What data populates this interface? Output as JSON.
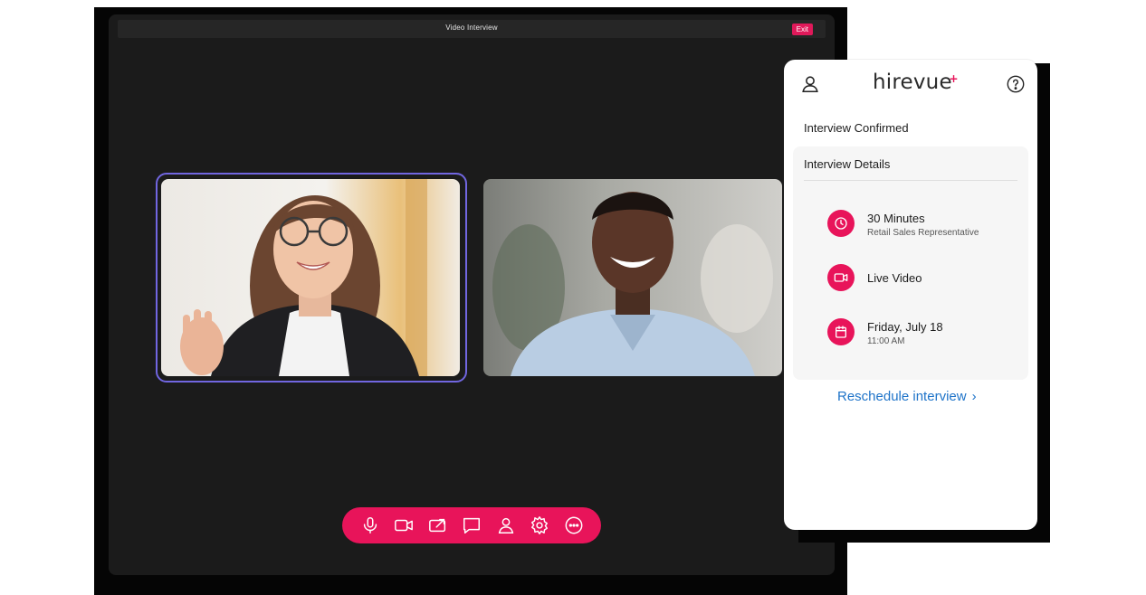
{
  "window": {
    "title": "Video Interview",
    "exit_label": "Exit"
  },
  "controls": [
    "microphone-icon",
    "camera-icon",
    "share-screen-icon",
    "chat-icon",
    "participants-icon",
    "settings-icon",
    "more-icon"
  ],
  "colors": {
    "accent": "#e8145a",
    "active_tile_border": "#7166e0",
    "link": "#1f74c9",
    "window_bg": "#1b1b1b"
  },
  "panel": {
    "logo": "hirevue",
    "status": "Interview Confirmed",
    "details_title": "Interview Details",
    "details": [
      {
        "icon": "clock-icon",
        "title": "30 Minutes",
        "subtitle": "Retail Sales Representative"
      },
      {
        "icon": "video-icon",
        "title": "Live Video",
        "subtitle": ""
      },
      {
        "icon": "calendar-icon",
        "title": "Friday, July 18",
        "subtitle": "11:00 AM"
      }
    ],
    "reschedule_label": "Reschedule interview"
  }
}
